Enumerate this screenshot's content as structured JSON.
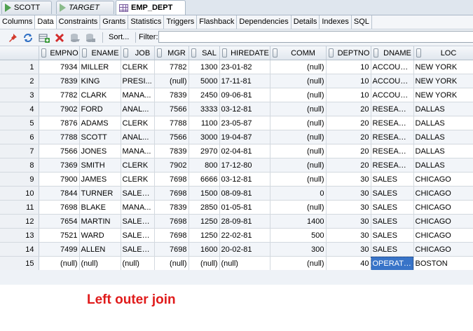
{
  "editor_tabs": [
    {
      "label": "SCOTT",
      "icon": "run-triangle-icon"
    },
    {
      "label": "TARGET",
      "icon": "run-triangle-hollow-icon"
    },
    {
      "label": "EMP_DEPT",
      "icon": "table-grid-icon"
    }
  ],
  "sub_tabs": [
    "Columns",
    "Data",
    "Constraints",
    "Grants",
    "Statistics",
    "Triggers",
    "Flashback",
    "Dependencies",
    "Details",
    "Indexes",
    "SQL"
  ],
  "active_sub_tab": "Data",
  "toolbar": {
    "sort_label": "Sort...",
    "filter_label": "Filter:",
    "filter_value": "",
    "icons": [
      "pin-icon",
      "refresh-icon",
      "insert-row-icon",
      "delete-row-icon",
      "commit-icon",
      "rollback-icon"
    ]
  },
  "grid": {
    "columns": [
      "EMPNO",
      "ENAME",
      "JOB",
      "MGR",
      "SAL",
      "HIREDATE",
      "COMM",
      "DEPTNO",
      "DNAME",
      "LOC"
    ],
    "rows": [
      [
        "1",
        "7934",
        "MILLER",
        "CLERK",
        "7782",
        "1300",
        "23-01-82",
        "(null)",
        "10",
        "ACCOUN...",
        "NEW YORK"
      ],
      [
        "2",
        "7839",
        "KING",
        "PRESI...",
        "(null)",
        "5000",
        "17-11-81",
        "(null)",
        "10",
        "ACCOUN...",
        "NEW YORK"
      ],
      [
        "3",
        "7782",
        "CLARK",
        "MANA...",
        "7839",
        "2450",
        "09-06-81",
        "(null)",
        "10",
        "ACCOUN...",
        "NEW YORK"
      ],
      [
        "4",
        "7902",
        "FORD",
        "ANAL...",
        "7566",
        "3333",
        "03-12-81",
        "(null)",
        "20",
        "RESEARCH",
        "DALLAS"
      ],
      [
        "5",
        "7876",
        "ADAMS",
        "CLERK",
        "7788",
        "1100",
        "23-05-87",
        "(null)",
        "20",
        "RESEARCH",
        "DALLAS"
      ],
      [
        "6",
        "7788",
        "SCOTT",
        "ANAL...",
        "7566",
        "3000",
        "19-04-87",
        "(null)",
        "20",
        "RESEARCH",
        "DALLAS"
      ],
      [
        "7",
        "7566",
        "JONES",
        "MANA...",
        "7839",
        "2970",
        "02-04-81",
        "(null)",
        "20",
        "RESEARCH",
        "DALLAS"
      ],
      [
        "8",
        "7369",
        "SMITH",
        "CLERK",
        "7902",
        "800",
        "17-12-80",
        "(null)",
        "20",
        "RESEARCH",
        "DALLAS"
      ],
      [
        "9",
        "7900",
        "JAMES",
        "CLERK",
        "7698",
        "6666",
        "03-12-81",
        "(null)",
        "30",
        "SALES",
        "CHICAGO"
      ],
      [
        "10",
        "7844",
        "TURNER",
        "SALES...",
        "7698",
        "1500",
        "08-09-81",
        "0",
        "30",
        "SALES",
        "CHICAGO"
      ],
      [
        "11",
        "7698",
        "BLAKE",
        "MANA...",
        "7839",
        "2850",
        "01-05-81",
        "(null)",
        "30",
        "SALES",
        "CHICAGO"
      ],
      [
        "12",
        "7654",
        "MARTIN",
        "SALES...",
        "7698",
        "1250",
        "28-09-81",
        "1400",
        "30",
        "SALES",
        "CHICAGO"
      ],
      [
        "13",
        "7521",
        "WARD",
        "SALES...",
        "7698",
        "1250",
        "22-02-81",
        "500",
        "30",
        "SALES",
        "CHICAGO"
      ],
      [
        "14",
        "7499",
        "ALLEN",
        "SALES...",
        "7698",
        "1600",
        "20-02-81",
        "300",
        "30",
        "SALES",
        "CHICAGO"
      ],
      [
        "15",
        "(null)",
        "(null)",
        "(null)",
        "(null)",
        "(null)",
        "(null)",
        "(null)",
        "40",
        "OPERATI...",
        "BOSTON"
      ]
    ],
    "selected_cell": {
      "row": 15,
      "column": "DNAME"
    }
  },
  "caption": "Left outer join",
  "colors": {
    "caption": "#e01b1b",
    "selection": "#3874c8"
  }
}
